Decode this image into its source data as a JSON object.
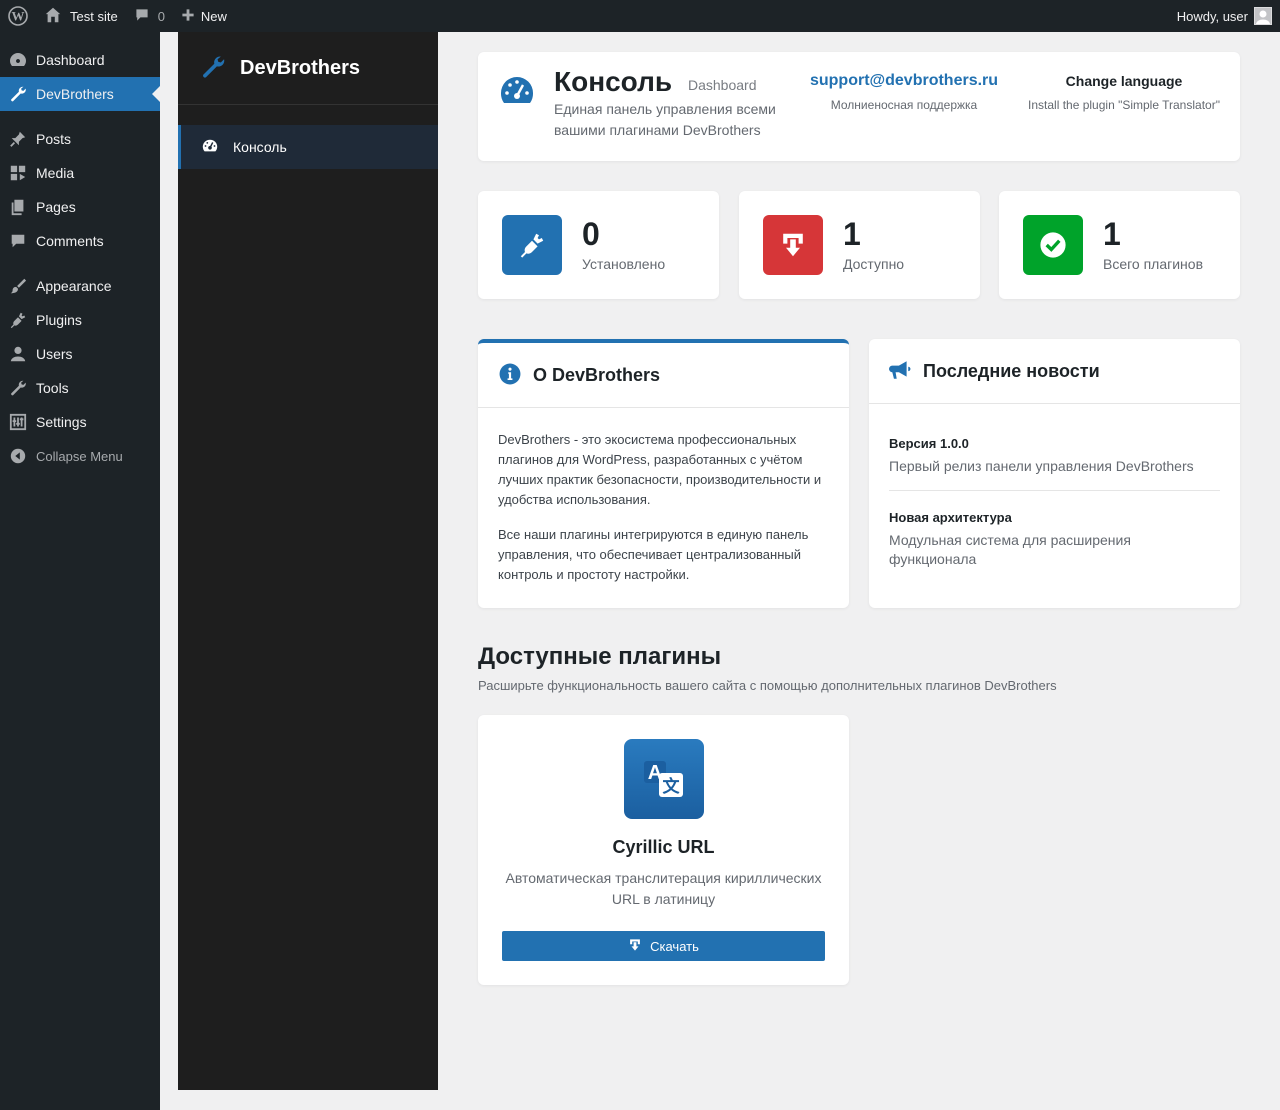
{
  "adminbar": {
    "site_name": "Test site",
    "comments_count": "0",
    "new_label": "New",
    "howdy": "Howdy, user"
  },
  "adminmenu": {
    "items": [
      {
        "label": "Dashboard",
        "icon": "dashboard-icon"
      },
      {
        "label": "DevBrothers",
        "icon": "wrench-icon"
      },
      {
        "label": "Posts",
        "icon": "pin-icon"
      },
      {
        "label": "Media",
        "icon": "media-icon"
      },
      {
        "label": "Pages",
        "icon": "pages-icon"
      },
      {
        "label": "Comments",
        "icon": "comment-icon"
      },
      {
        "label": "Appearance",
        "icon": "brush-icon"
      },
      {
        "label": "Plugins",
        "icon": "plug-icon"
      },
      {
        "label": "Users",
        "icon": "user-icon"
      },
      {
        "label": "Tools",
        "icon": "wrench-icon"
      },
      {
        "label": "Settings",
        "icon": "sliders-icon"
      }
    ],
    "collapse_label": "Collapse Menu"
  },
  "sidebar": {
    "brand": "DevBrothers",
    "nav": [
      {
        "label": "Консоль",
        "icon": "gauge-icon"
      }
    ]
  },
  "header": {
    "title": "Консоль",
    "subtitle": "Dashboard",
    "description": "Единая панель управления всеми вашими плагинами DevBrothers",
    "support_email": "support@devbrothers.ru",
    "support_note": "Молниеносная поддержка",
    "language_title": "Change language",
    "language_note": "Install the plugin \"Simple Translator\""
  },
  "stats": [
    {
      "value": "0",
      "label": "Установлено",
      "color": "#2271b1",
      "icon": "plug-icon"
    },
    {
      "value": "1",
      "label": "Доступно",
      "color": "#d63638",
      "icon": "download-icon"
    },
    {
      "value": "1",
      "label": "Всего плагинов",
      "color": "#00a32a",
      "icon": "check-circle-icon"
    }
  ],
  "about": {
    "title": "О DevBrothers",
    "p1": "DevBrothers - это экосистема профессиональных плагинов для WordPress, разработанных с учётом лучших практик безопасности, производительности и удобства использования.",
    "p2": "Все наши плагины интегрируются в единую панель управления, что обеспечивает централизованный контроль и простоту настройки."
  },
  "news": {
    "title": "Последние новости",
    "items": [
      {
        "title": "Версия 1.0.0",
        "desc": "Первый релиз панели управления DevBrothers"
      },
      {
        "title": "Новая архитектура",
        "desc": "Модульная система для расширения функционала"
      }
    ]
  },
  "plugins_section": {
    "title": "Доступные плагины",
    "subtitle": "Расширьте функциональность вашего сайта с помощью дополнительных плагинов DevBrothers",
    "cards": [
      {
        "name": "Cyrillic URL",
        "desc": "Автоматическая транслитерация кириллических URL в латиницу",
        "button": "Скачать",
        "icon": "translate-icon"
      }
    ]
  }
}
